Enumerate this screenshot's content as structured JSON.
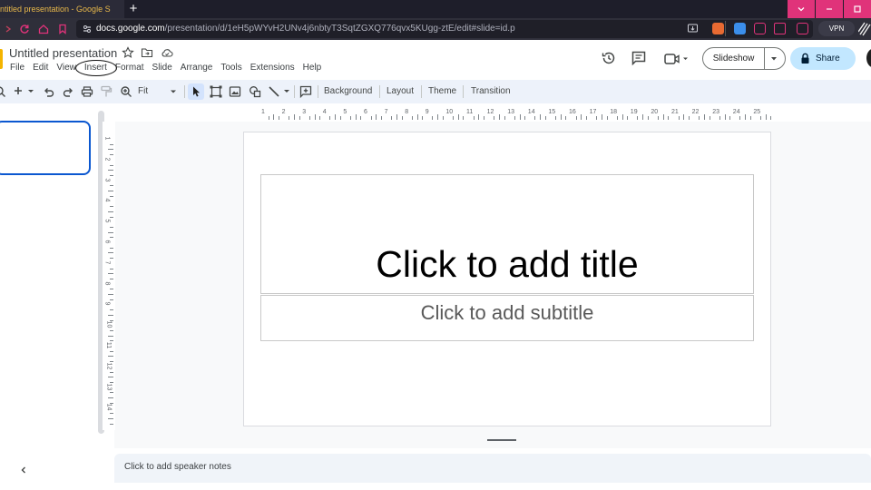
{
  "browser": {
    "tab_title": "ntitled presentation - Google S",
    "new_tab": "+",
    "url_domain": "docs.google.com",
    "url_path": "/presentation/d/1eH5pWYvH2UNv4j6nbtyT3SqtZGXQ776qvx5KUgg-ztE/edit#slide=id.p",
    "vpn_label": "VPN",
    "accent_color": "#e0337a"
  },
  "document": {
    "title": "Untitled presentation"
  },
  "menu": {
    "items": [
      "File",
      "Edit",
      "View",
      "Insert",
      "Format",
      "Slide",
      "Arrange",
      "Tools",
      "Extensions",
      "Help"
    ],
    "highlighted": "Insert"
  },
  "header": {
    "slideshow_label": "Slideshow",
    "share_label": "Share"
  },
  "toolbar": {
    "zoom_label": "Fit",
    "background_label": "Background",
    "layout_label": "Layout",
    "theme_label": "Theme",
    "transition_label": "Transition"
  },
  "slide": {
    "title_placeholder": "Click to add title",
    "subtitle_placeholder": "Click to add subtitle"
  },
  "notes": {
    "placeholder": "Click to add speaker notes"
  },
  "rulers": {
    "horizontal": [
      "1",
      "2",
      "3",
      "4",
      "5",
      "6",
      "7",
      "8",
      "9",
      "10",
      "11",
      "12",
      "13",
      "14",
      "15",
      "16",
      "17",
      "18",
      "19",
      "20",
      "21",
      "22",
      "23",
      "24",
      "25"
    ],
    "vertical": [
      "1",
      "2",
      "3",
      "4",
      "5",
      "6",
      "7",
      "8",
      "9",
      "10",
      "11",
      "12",
      "13",
      "14"
    ]
  }
}
